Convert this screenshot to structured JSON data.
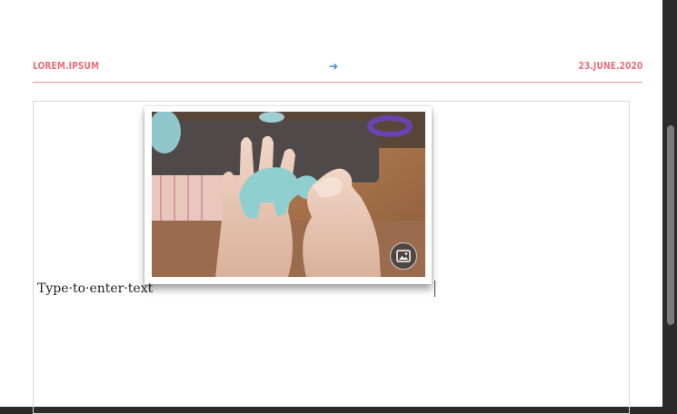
{
  "header": {
    "left_text": "LOREM.IPSUM",
    "arrow": "➔",
    "right_text": "23.JUNE.2020",
    "accent_color": "#ec6b78",
    "arrow_color": "#3a86c8"
  },
  "image": {
    "badge_icon": "image-icon"
  },
  "body": {
    "text": "Type·to·enter·text"
  }
}
